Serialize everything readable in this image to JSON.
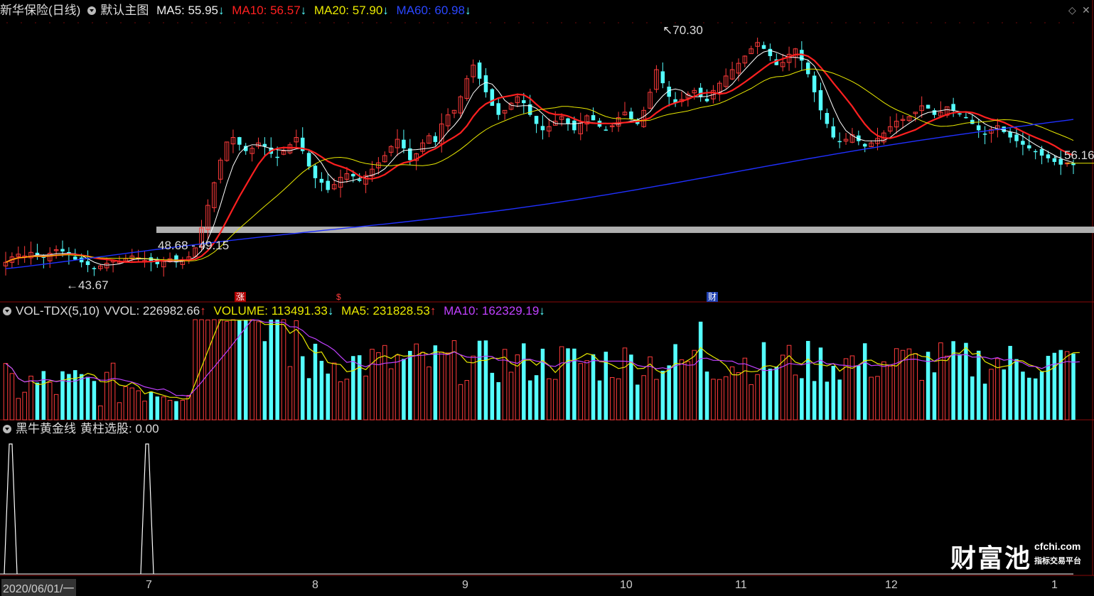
{
  "header": {
    "title": "新华保险(日线)",
    "template_label": "默认主图",
    "ma5": "MA5: 55.95",
    "ma10": "MA10: 56.57",
    "ma20": "MA20: 57.90",
    "ma60": "MA60: 60.98",
    "arrow_down": "↓",
    "arrow_up": "↑"
  },
  "volume_panel": {
    "label": "VOL-TDX(5,10)",
    "vvol": "VVOL: 226982.66",
    "volume": "VOLUME: 113491.33",
    "ma5": "MA5: 231828.53",
    "ma10": "MA10: 162329.19"
  },
  "indicator_panel": {
    "label": "黑牛黄金线",
    "value": "黄柱选股: 0.00"
  },
  "annotations": {
    "high": "70.30",
    "low": "43.67",
    "last": "56.16",
    "support_zone": "48.68 - 49.15"
  },
  "event_markers": [
    "涨",
    "$",
    "财"
  ],
  "x_axis": {
    "start": "2020/06/01/一",
    "months": [
      "7",
      "8",
      "9",
      "10",
      "11",
      "12",
      "1"
    ]
  },
  "watermark": {
    "brand": "财富池",
    "site": "cfchi.com",
    "tagline": "指标交易平台"
  },
  "colors": {
    "background": "#000000",
    "up": "#ff3b3b",
    "down": "#54ffff",
    "ma5": "#ffffff",
    "ma10": "#ff2020",
    "ma20": "#e8e800",
    "ma60": "#2030ff",
    "vol_ma10": "#c040ff"
  },
  "chart_data": {
    "type": "candlestick",
    "ylim": [
      42,
      72
    ],
    "closes": [
      45.2,
      45.8,
      46.1,
      45.9,
      46.3,
      46.0,
      45.7,
      46.2,
      46.6,
      46.4,
      46.0,
      45.5,
      45.2,
      44.9,
      44.5,
      44.8,
      45.1,
      45.4,
      45.3,
      45.6,
      45.9,
      45.7,
      45.4,
      45.2,
      45.0,
      45.3,
      45.6,
      45.2,
      45.5,
      45.8,
      46.8,
      49.0,
      51.5,
      54.0,
      56.5,
      58.5,
      59.0,
      58.2,
      57.5,
      57.8,
      58.4,
      58.0,
      57.2,
      56.8,
      57.5,
      58.2,
      59.0,
      57.5,
      55.8,
      54.5,
      54.0,
      53.2,
      53.8,
      54.6,
      55.0,
      54.7,
      54.2,
      54.8,
      55.5,
      56.2,
      57.0,
      58.0,
      58.8,
      57.8,
      56.5,
      57.2,
      58.4,
      59.2,
      58.5,
      60.5,
      61.5,
      62.0,
      63.5,
      65.5,
      67.0,
      65.5,
      64.0,
      62.5,
      61.5,
      62.0,
      62.8,
      63.5,
      62.8,
      61.5,
      60.5,
      59.8,
      60.2,
      60.8,
      61.3,
      60.5,
      59.8,
      60.6,
      61.4,
      60.9,
      60.2,
      59.8,
      60.3,
      61.2,
      61.8,
      61.0,
      60.5,
      62.0,
      64.0,
      66.5,
      65.0,
      63.5,
      62.8,
      63.2,
      63.8,
      64.2,
      63.5,
      63.0,
      64.2,
      65.0,
      65.8,
      66.5,
      67.2,
      68.0,
      68.8,
      69.5,
      68.8,
      68.0,
      67.0,
      67.3,
      68.2,
      68.8,
      67.5,
      66.0,
      64.0,
      62.0,
      60.5,
      59.0,
      58.5,
      58.8,
      59.3,
      58.6,
      58.0,
      58.4,
      58.9,
      59.5,
      60.2,
      60.8,
      61.0,
      61.3,
      61.8,
      62.5,
      62.2,
      61.5,
      61.8,
      62.4,
      62.0,
      61.6,
      61.2,
      60.5,
      59.8,
      59.4,
      59.9,
      60.3,
      59.6,
      59.0,
      58.6,
      58.2,
      57.8,
      57.4,
      57.0,
      56.7,
      56.3,
      56.0,
      56.2,
      55.95
    ],
    "volume_note": "per-bar volume heights drawn proportionally",
    "series": [
      {
        "name": "MA5",
        "color": "#ffffff"
      },
      {
        "name": "MA10",
        "color": "#ff2020"
      },
      {
        "name": "MA20",
        "color": "#e8e800"
      },
      {
        "name": "MA60",
        "color": "#2030ff"
      }
    ],
    "support_band": [
      48.68,
      49.15
    ],
    "annotated_high": 70.3,
    "annotated_low": 43.67,
    "last_price": 56.16,
    "indicator_spikes_at_bar": [
      3,
      41
    ]
  }
}
